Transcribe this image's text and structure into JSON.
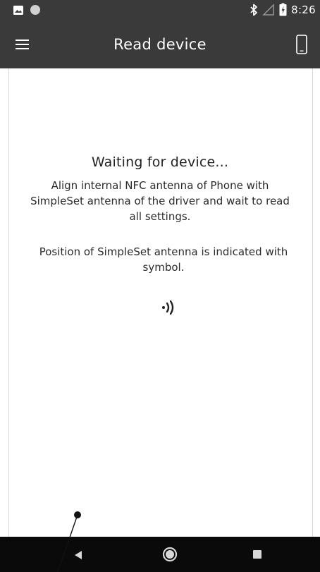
{
  "status_bar": {
    "time": "8:26",
    "icons": [
      "image-notification-icon",
      "circle-notification-icon",
      "bluetooth-icon",
      "signal-icon",
      "battery-icon"
    ]
  },
  "app_bar": {
    "title": "Read device",
    "menu_icon": "hamburger-menu-icon",
    "action_icon": "phone-icon"
  },
  "content": {
    "title": "Waiting for device...",
    "instruction_line1": "Align internal NFC antenna of Phone with",
    "instruction_line2": "SimpleSet antenna of the driver and wait to read",
    "instruction_line3": "all settings.",
    "position_line1": "Position of SimpleSet antenna is indicated with",
    "position_line2": "symbol.",
    "symbol_icon": "nfc-symbol-icon"
  },
  "nav_bar": {
    "back_icon": "back-triangle-icon",
    "home_icon": "home-circle-icon",
    "recents_icon": "recents-square-icon"
  },
  "colors": {
    "app_bar": "#3a3a3a",
    "nav_bar": "#0a0a0a",
    "background": "#ffffff",
    "text": "#2b2b2b"
  }
}
